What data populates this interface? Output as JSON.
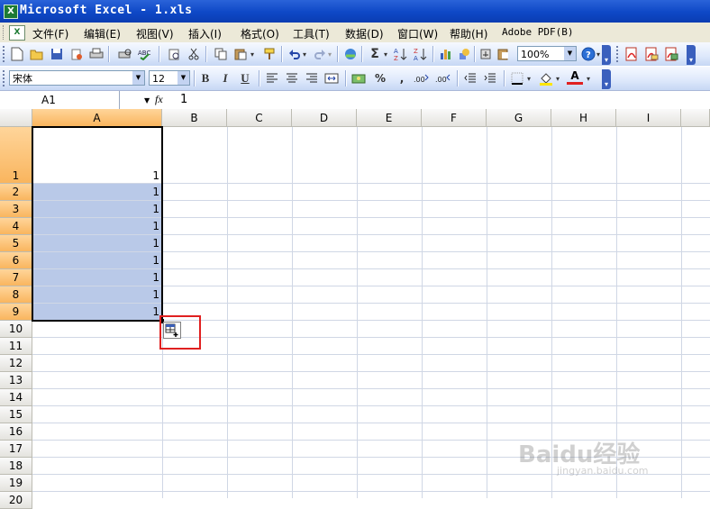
{
  "window": {
    "title": "Microsoft Excel - 1.xls",
    "app_icon": "X"
  },
  "menu": {
    "doc_icon": "X",
    "items": [
      "文件(F)",
      "编辑(E)",
      "视图(V)",
      "插入(I)",
      "格式(O)",
      "工具(T)",
      "数据(D)",
      "窗口(W)",
      "帮助(H)",
      "Adobe PDF(B)"
    ]
  },
  "toolbar_standard": {
    "icons": [
      "new-icon",
      "open-icon",
      "save-icon",
      "permission-icon",
      "print-icon",
      "print-preview-icon",
      "spelling-icon",
      "research-icon",
      "cut-icon",
      "copy-icon",
      "paste-icon",
      "format-painter-icon",
      "undo-icon",
      "redo-icon",
      "hyperlink-icon",
      "autosum-icon",
      "sort-asc-icon",
      "sort-desc-icon",
      "chart-wizard-icon",
      "drawing-icon",
      "help-icon",
      "pdf-convert-icon",
      "pdf-email-icon",
      "pdf-review-icon"
    ],
    "zoom": "100%"
  },
  "toolbar_formatting": {
    "font_name": "宋体",
    "font_size": "12",
    "bold": "B",
    "italic": "I",
    "underline": "U",
    "percent": "%",
    "comma": ",",
    "font_color_glyph": "A"
  },
  "formula_bar": {
    "name_box": "A1",
    "fx": "fx",
    "value": "1"
  },
  "sheet": {
    "columns": [
      "A",
      "B",
      "C",
      "D",
      "E",
      "F",
      "G",
      "H",
      "I"
    ],
    "rows": [
      "1",
      "2",
      "3",
      "4",
      "5",
      "6",
      "7",
      "8",
      "9",
      "10",
      "11",
      "12",
      "13",
      "14",
      "15",
      "16",
      "17",
      "18",
      "19",
      "20"
    ],
    "cells_A": [
      "1",
      "1",
      "1",
      "1",
      "1",
      "1",
      "1",
      "1",
      "1"
    ],
    "selected_range": "A1:A9"
  },
  "watermark": {
    "brand": "Baidu经验",
    "url": "jingyan.baidu.com"
  },
  "colors": {
    "title": "#0e48c6",
    "selection": "#b9c9e8",
    "header_sel": "#f9b55e",
    "highlight_box": "#e02020"
  }
}
